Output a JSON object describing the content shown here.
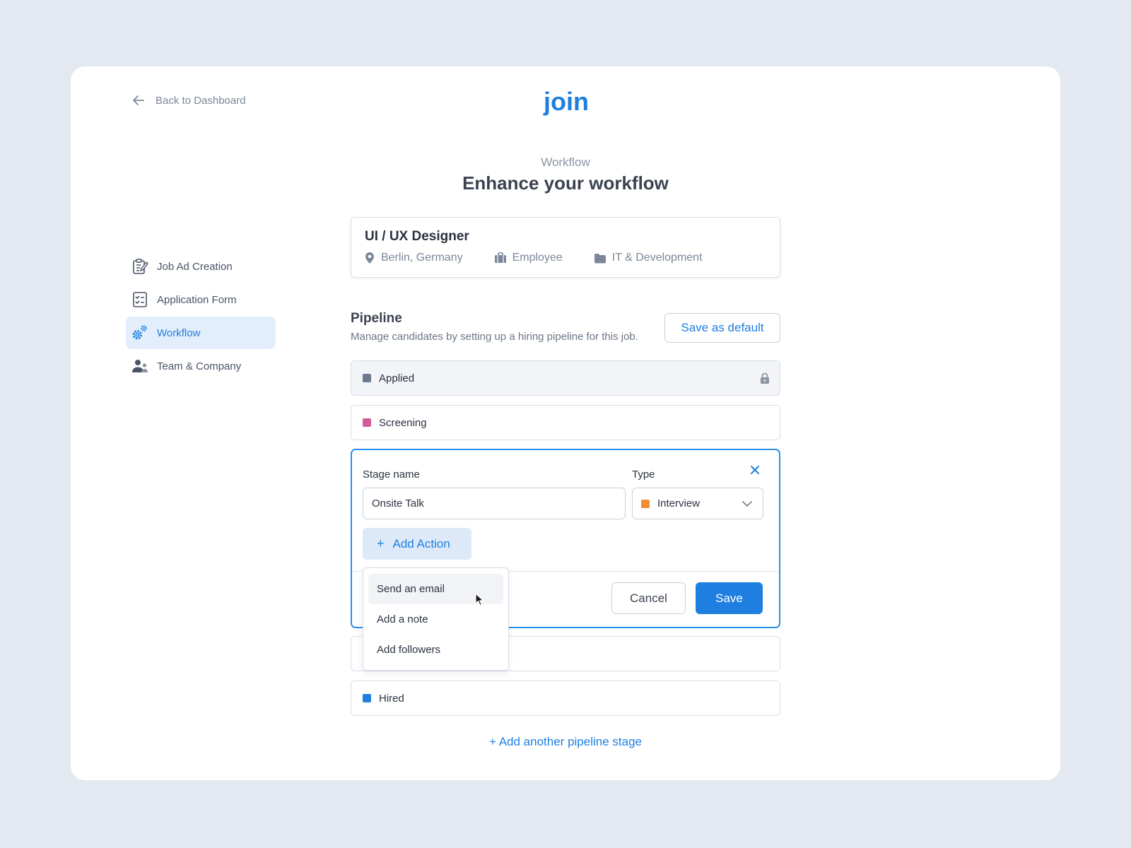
{
  "header": {
    "back_label": "Back to Dashboard",
    "logo_text": "join",
    "eyebrow": "Workflow",
    "title": "Enhance your workflow"
  },
  "nav": {
    "items": [
      {
        "label": "Job Ad Creation",
        "icon": "edit-doc-icon",
        "active": false
      },
      {
        "label": "Application Form",
        "icon": "checklist-icon",
        "active": false
      },
      {
        "label": "Workflow",
        "icon": "gears-icon",
        "active": true
      },
      {
        "label": "Team & Company",
        "icon": "people-icon",
        "active": false
      }
    ]
  },
  "job": {
    "title": "UI / UX Designer",
    "location": "Berlin, Germany",
    "employment": "Employee",
    "category": "IT & Development"
  },
  "pipeline": {
    "title": "Pipeline",
    "description": "Manage candidates by setting up a hiring pipeline for this job.",
    "save_default_label": "Save as default",
    "stages": [
      {
        "label": "Applied",
        "color": "#6c7a90",
        "locked": true
      },
      {
        "label": "Screening",
        "color": "#d55a9a",
        "locked": false
      },
      {
        "label": "",
        "color": "",
        "locked": false
      },
      {
        "label": "Hired",
        "color": "#1e7fe0",
        "locked": false
      }
    ],
    "add_stage_label": "+ Add another pipeline stage"
  },
  "editor": {
    "stage_name_label": "Stage name",
    "stage_name_value": "Onsite Talk",
    "type_label": "Type",
    "type_value": "Interview",
    "type_color": "#f28c38",
    "add_action_label": "Add Action",
    "cancel_label": "Cancel",
    "save_label": "Save"
  },
  "action_menu": {
    "items": [
      "Send an email",
      "Add a note",
      "Add followers"
    ],
    "hovered_index": 0
  },
  "colors": {
    "accent": "#1e7fe0",
    "background": "#e4e9f1"
  }
}
